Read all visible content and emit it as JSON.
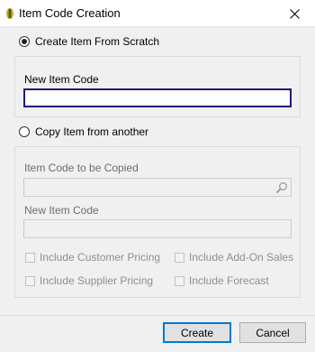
{
  "window": {
    "title": "Item Code Creation"
  },
  "scratch": {
    "radio_label": "Create Item From Scratch",
    "selected": true,
    "new_item_code_label": "New Item Code",
    "new_item_code_value": ""
  },
  "copy": {
    "radio_label": "Copy Item from another",
    "selected": false,
    "code_to_copy_label": "Item Code to be Copied",
    "code_to_copy_value": "",
    "new_item_code_label": "New Item Code",
    "new_item_code_value": "",
    "checkboxes": [
      {
        "label": "Include Customer Pricing",
        "checked": false
      },
      {
        "label": "Include Add-On Sales",
        "checked": false
      },
      {
        "label": "Include Supplier Pricing",
        "checked": false
      },
      {
        "label": "Include Forecast",
        "checked": false
      }
    ]
  },
  "footer": {
    "create_label": "Create",
    "cancel_label": "Cancel"
  },
  "icons": {
    "app": "app-logo-icon",
    "close": "close-icon",
    "lookup": "search-icon"
  },
  "colors": {
    "focus_border": "#1e1a78",
    "primary_button_border": "#0078d7"
  }
}
